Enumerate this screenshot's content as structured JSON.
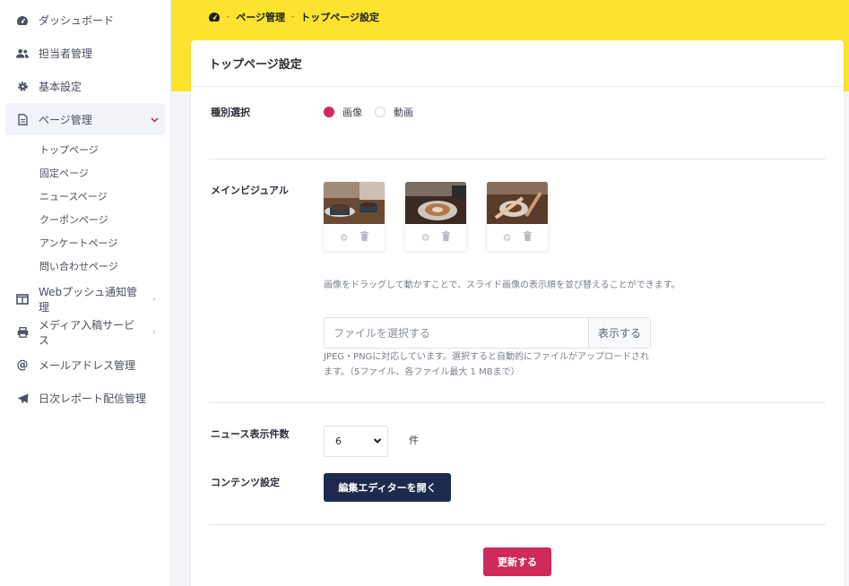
{
  "sidebar": {
    "items": [
      {
        "label": "ダッシュボード",
        "icon": "dashboard-gauge-icon"
      },
      {
        "label": "担当者管理",
        "icon": "users-icon"
      },
      {
        "label": "基本設定",
        "icon": "gear-icon"
      },
      {
        "label": "ページ管理",
        "icon": "document-icon",
        "active": true
      },
      {
        "label": "Webプッシュ通知管理",
        "icon": "panel-icon"
      },
      {
        "label": "メディア入稿サービス",
        "icon": "printer-icon"
      },
      {
        "label": "メールアドレス管理",
        "icon": "at-sign-icon"
      },
      {
        "label": "日次レポート配信管理",
        "icon": "paper-plane-icon"
      }
    ],
    "sub_items": [
      "トップページ",
      "固定ページ",
      "ニュースページ",
      "クーポンページ",
      "アンケートページ",
      "問い合わせページ"
    ]
  },
  "breadcrumb": {
    "home_icon": "dashboard-gauge-icon",
    "items": [
      "ページ管理",
      "トップページ設定"
    ]
  },
  "card": {
    "title": "トップページ設定",
    "type_select": {
      "label": "種別選択",
      "options": [
        "画像",
        "動画"
      ],
      "selected": "画像"
    },
    "main_visual": {
      "label": "メインビジュアル",
      "hint": "画像をドラッグして動かすことで、スライド画像の表示順を並び替えることができます。",
      "file_placeholder": "ファイルを選択する",
      "file_button": "表示する",
      "file_note": "JPEG・PNGに対応しています。選択すると自動的にファイルがアップロードされます。（5ファイル、各ファイル最大 1 MBまで）"
    },
    "news_count": {
      "label": "ニュース表示件数",
      "value": "6",
      "unit": "件"
    },
    "contents": {
      "label": "コンテンツ設定",
      "button": "編集エディターを開く"
    },
    "submit": "更新する"
  },
  "colors": {
    "accent": "#cf2a5a",
    "navy": "#1c2b4d",
    "band": "#fce32e"
  }
}
